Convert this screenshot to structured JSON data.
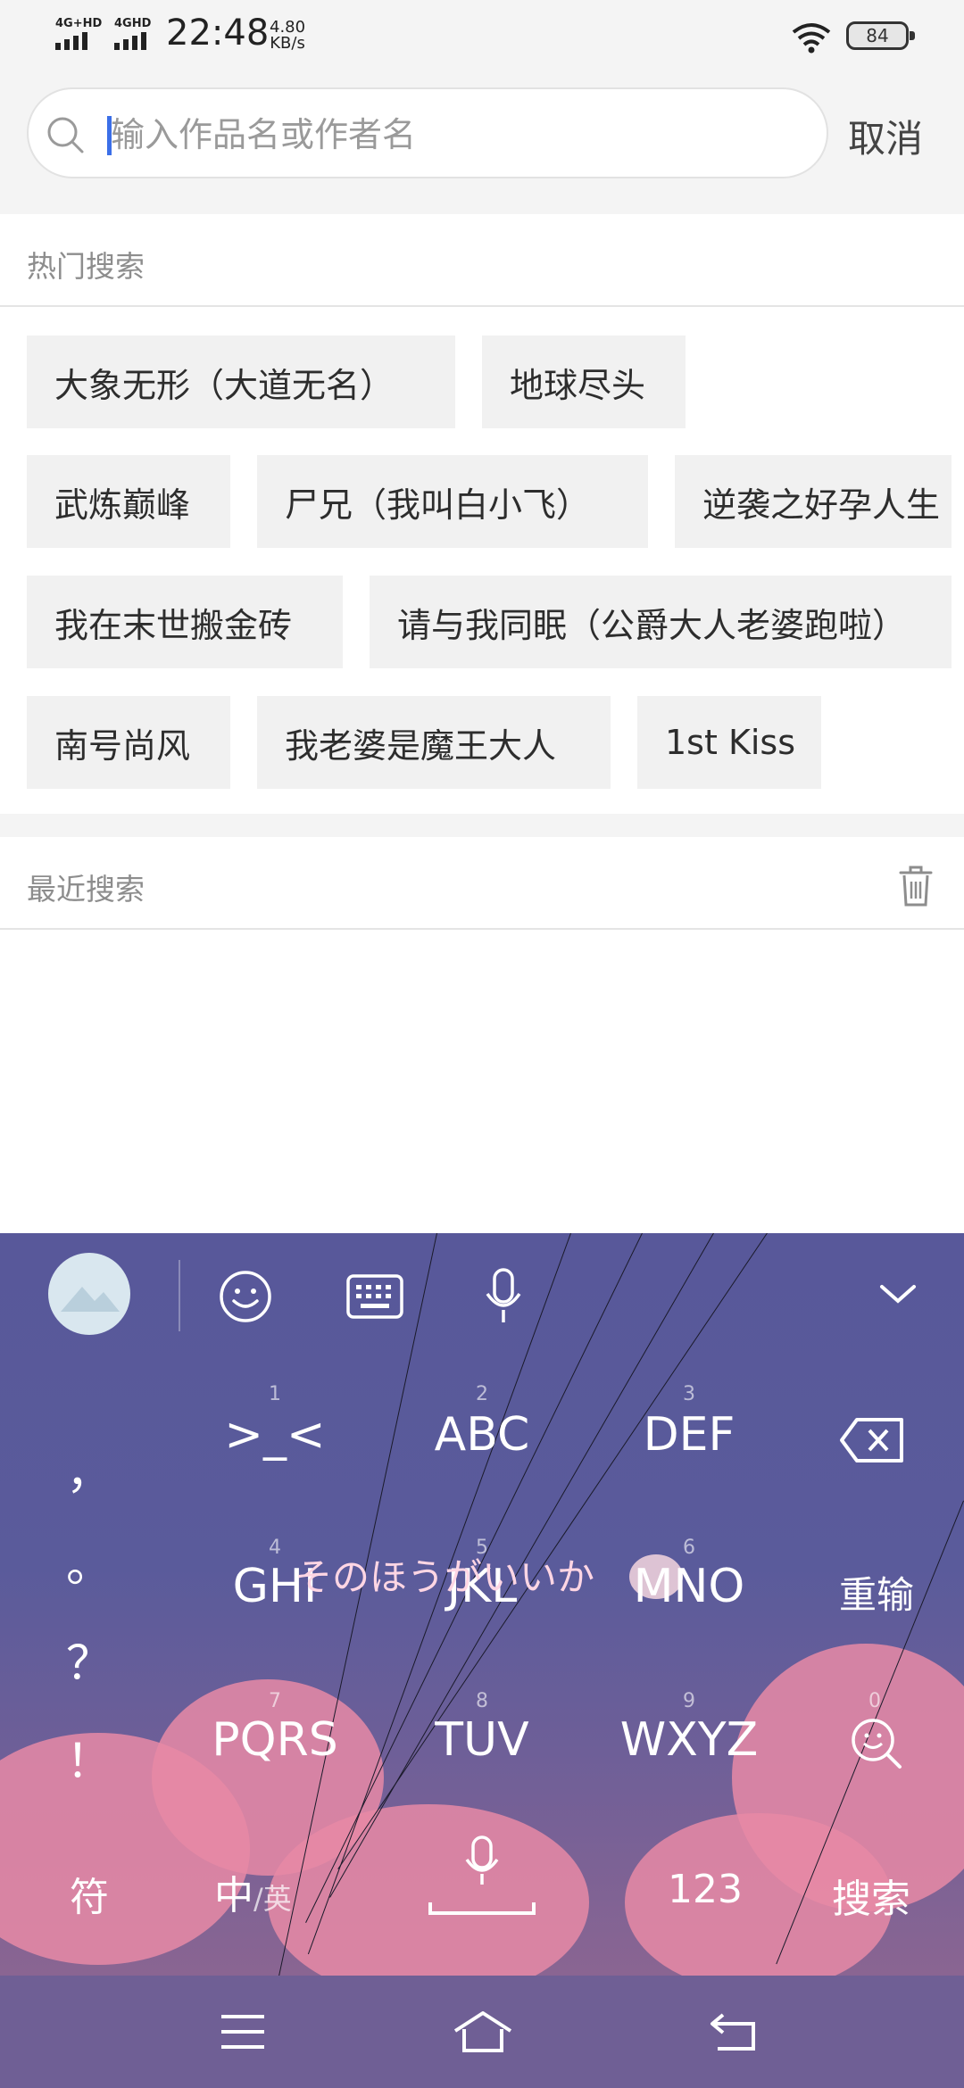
{
  "status_bar": {
    "signal1": "4G+HD",
    "signal2": "4GHD",
    "time": "22:48",
    "speed_value": "4.80",
    "speed_unit": "KB/s",
    "battery": "84"
  },
  "search": {
    "placeholder": "输入作品名或作者名",
    "cancel_label": "取消"
  },
  "hot_search": {
    "title": "热门搜索",
    "tags": [
      "大象无形（大道无名）",
      "地球尽头",
      "武炼巅峰",
      "尸兄（我叫白小飞）",
      "逆袭之好孕人生",
      "我在末世搬金砖",
      "请与我同眠（公爵大人老婆跑啦）",
      "南号尚风",
      "我老婆是魔王大人",
      "1st Kiss"
    ]
  },
  "recent_search": {
    "title": "最近搜索"
  },
  "keyboard": {
    "theme_text": "そのほうがいいか",
    "punctuation": [
      "，",
      "。",
      "？",
      "！"
    ],
    "keys": {
      "k1": {
        "num": "1",
        "label": ">_<"
      },
      "k2": {
        "num": "2",
        "label": "ABC"
      },
      "k3": {
        "num": "3",
        "label": "DEF"
      },
      "k4": {
        "num": "4",
        "label": "GHI"
      },
      "k5": {
        "num": "5",
        "label": "JKL"
      },
      "k6": {
        "num": "6",
        "label": "MNO"
      },
      "k7": {
        "num": "7",
        "label": "PQRS"
      },
      "k8": {
        "num": "8",
        "label": "TUV"
      },
      "k9": {
        "num": "9",
        "label": "WXYZ"
      },
      "k0": {
        "num": "0"
      }
    },
    "relearn_label": "重输",
    "symbol_label": "符",
    "lang_main": "中",
    "lang_sub": "/英",
    "num_label": "123",
    "search_label": "搜索"
  }
}
